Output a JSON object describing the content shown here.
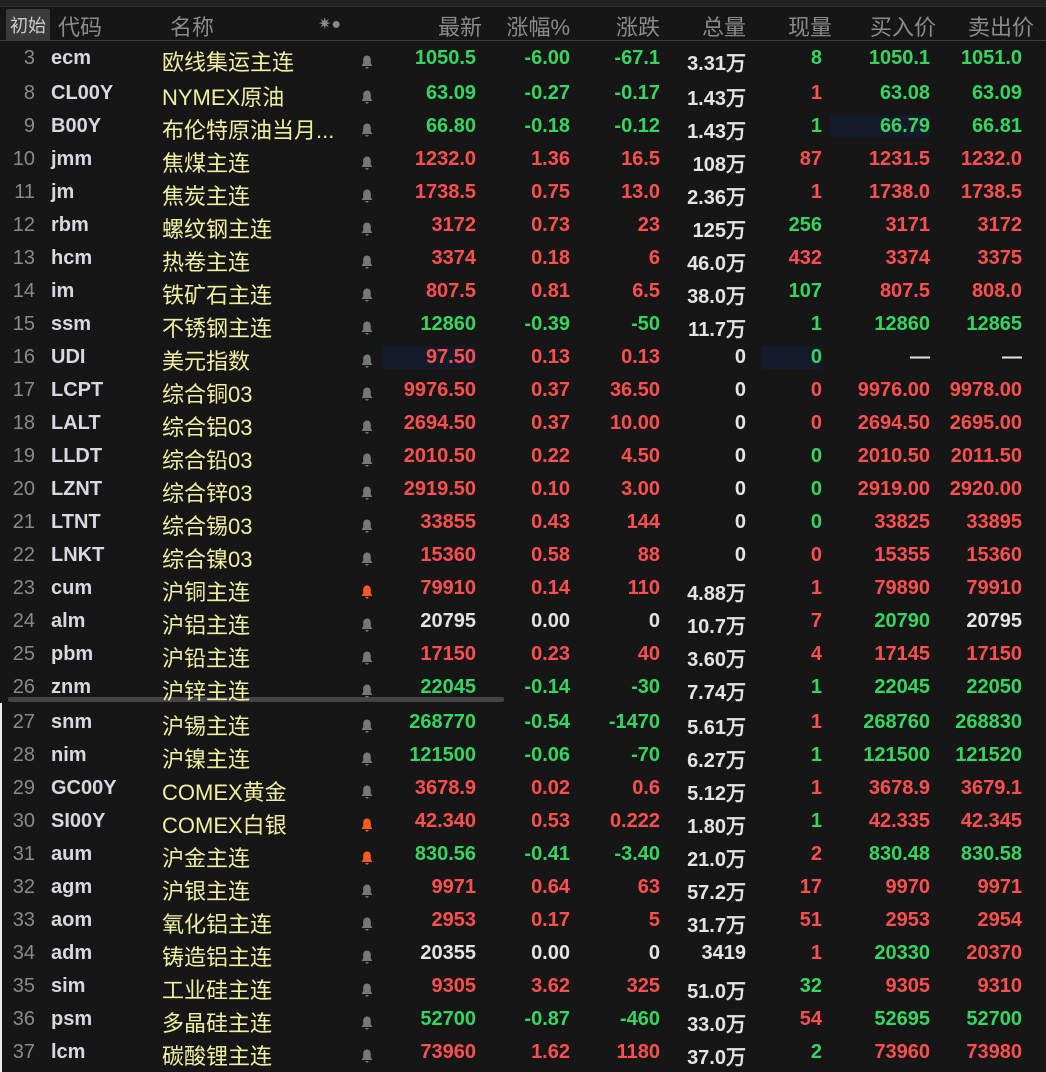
{
  "header": {
    "init": "初始",
    "code": "代码",
    "name": "名称",
    "icons": "✷●",
    "last": "最新",
    "pct": "涨幅%",
    "chg": "涨跌",
    "vol": "总量",
    "cur": "现量",
    "bid": "买入价",
    "ask": "卖出价"
  },
  "colors": {
    "green": "#35d660",
    "red": "#ff4f4f",
    "name": "#f2f0a0",
    "bell": "#777777",
    "bell_active": "#ff5a1f"
  },
  "rows": [
    {
      "n": "3",
      "code": "ecm",
      "name": "欧线集运主连",
      "bell": "gray",
      "v": [
        "1050.5",
        "-6.00",
        "-67.1",
        "3.31万",
        "8",
        "1050.1",
        "1051.0"
      ],
      "c": "gggwggg"
    },
    {
      "n": "8",
      "code": "CL00Y",
      "name": "NYMEX原油",
      "bell": "gray",
      "v": [
        "63.09",
        "-0.27",
        "-0.17",
        "1.43万",
        "1",
        "63.08",
        "63.09"
      ],
      "c": "gggwrgg"
    },
    {
      "n": "9",
      "code": "B00Y",
      "name": "布伦特原油当月...",
      "bell": "gray",
      "v": [
        "66.80",
        "-0.18",
        "-0.12",
        "1.43万",
        "1",
        "66.79",
        "66.81"
      ],
      "c": "gggwggg"
    },
    {
      "n": "10",
      "code": "jmm",
      "name": "焦煤主连",
      "bell": "gray",
      "v": [
        "1232.0",
        "1.36",
        "16.5",
        "108万",
        "87",
        "1231.5",
        "1232.0"
      ],
      "c": "rrrwrrr"
    },
    {
      "n": "11",
      "code": "jm",
      "name": "焦炭主连",
      "bell": "gray",
      "v": [
        "1738.5",
        "0.75",
        "13.0",
        "2.36万",
        "1",
        "1738.0",
        "1738.5"
      ],
      "c": "rrrwrrr"
    },
    {
      "n": "12",
      "code": "rbm",
      "name": "螺纹钢主连",
      "bell": "gray",
      "v": [
        "3172",
        "0.73",
        "23",
        "125万",
        "256",
        "3171",
        "3172"
      ],
      "c": "rrrwgrr"
    },
    {
      "n": "13",
      "code": "hcm",
      "name": "热卷主连",
      "bell": "gray",
      "v": [
        "3374",
        "0.18",
        "6",
        "46.0万",
        "432",
        "3374",
        "3375"
      ],
      "c": "rrrwrrr"
    },
    {
      "n": "14",
      "code": "im",
      "name": "铁矿石主连",
      "bell": "gray",
      "v": [
        "807.5",
        "0.81",
        "6.5",
        "38.0万",
        "107",
        "807.5",
        "808.0"
      ],
      "c": "rrrwgrr"
    },
    {
      "n": "15",
      "code": "ssm",
      "name": "不锈钢主连",
      "bell": "gray",
      "v": [
        "12860",
        "-0.39",
        "-50",
        "11.7万",
        "1",
        "12860",
        "12865"
      ],
      "c": "gggwggg"
    },
    {
      "n": "16",
      "code": "UDI",
      "name": "美元指数",
      "bell": "gray",
      "v": [
        "97.50",
        "0.13",
        "0.13",
        "0",
        "0",
        "—",
        "—"
      ],
      "c": "rrrwgww"
    },
    {
      "n": "17",
      "code": "LCPT",
      "name": "综合铜03",
      "bell": "gray",
      "v": [
        "9976.50",
        "0.37",
        "36.50",
        "0",
        "0",
        "9976.00",
        "9978.00"
      ],
      "c": "rrrwrrr"
    },
    {
      "n": "18",
      "code": "LALT",
      "name": "综合铝03",
      "bell": "gray",
      "v": [
        "2694.50",
        "0.37",
        "10.00",
        "0",
        "0",
        "2694.50",
        "2695.00"
      ],
      "c": "rrrwrrr"
    },
    {
      "n": "19",
      "code": "LLDT",
      "name": "综合铅03",
      "bell": "gray",
      "v": [
        "2010.50",
        "0.22",
        "4.50",
        "0",
        "0",
        "2010.50",
        "2011.50"
      ],
      "c": "rrrwgrr"
    },
    {
      "n": "20",
      "code": "LZNT",
      "name": "综合锌03",
      "bell": "gray",
      "v": [
        "2919.50",
        "0.10",
        "3.00",
        "0",
        "0",
        "2919.00",
        "2920.00"
      ],
      "c": "rrrwgrr"
    },
    {
      "n": "21",
      "code": "LTNT",
      "name": "综合锡03",
      "bell": "gray",
      "v": [
        "33855",
        "0.43",
        "144",
        "0",
        "0",
        "33825",
        "33895"
      ],
      "c": "rrrwgrr"
    },
    {
      "n": "22",
      "code": "LNKT",
      "name": "综合镍03",
      "bell": "gray",
      "v": [
        "15360",
        "0.58",
        "88",
        "0",
        "0",
        "15355",
        "15360"
      ],
      "c": "rrrwrrr"
    },
    {
      "n": "23",
      "code": "cum",
      "name": "沪铜主连",
      "bell": "active",
      "v": [
        "79910",
        "0.14",
        "110",
        "4.88万",
        "1",
        "79890",
        "79910"
      ],
      "c": "rrrwrrr"
    },
    {
      "n": "24",
      "code": "alm",
      "name": "沪铝主连",
      "bell": "gray",
      "v": [
        "20795",
        "0.00",
        "0",
        "10.7万",
        "7",
        "20790",
        "20795"
      ],
      "c": "wwwwrgw"
    },
    {
      "n": "25",
      "code": "pbm",
      "name": "沪铅主连",
      "bell": "gray",
      "v": [
        "17150",
        "0.23",
        "40",
        "3.60万",
        "4",
        "17145",
        "17150"
      ],
      "c": "rrrwrrr"
    },
    {
      "n": "26",
      "code": "znm",
      "name": "沪锌主连",
      "bell": "gray",
      "v": [
        "22045",
        "-0.14",
        "-30",
        "7.74万",
        "1",
        "22045",
        "22050"
      ],
      "c": "gggwggg"
    },
    {
      "n": "27",
      "code": "snm",
      "name": "沪锡主连",
      "bell": "gray",
      "v": [
        "268770",
        "-0.54",
        "-1470",
        "5.61万",
        "1",
        "268760",
        "268830"
      ],
      "c": "gggwrgg"
    },
    {
      "n": "28",
      "code": "nim",
      "name": "沪镍主连",
      "bell": "gray",
      "v": [
        "121500",
        "-0.06",
        "-70",
        "6.27万",
        "1",
        "121500",
        "121520"
      ],
      "c": "gggwggg"
    },
    {
      "n": "29",
      "code": "GC00Y",
      "name": "COMEX黄金",
      "bell": "gray",
      "v": [
        "3678.9",
        "0.02",
        "0.6",
        "5.12万",
        "1",
        "3678.9",
        "3679.1"
      ],
      "c": "rrrwrrr"
    },
    {
      "n": "30",
      "code": "SI00Y",
      "name": "COMEX白银",
      "bell": "active",
      "v": [
        "42.340",
        "0.53",
        "0.222",
        "1.80万",
        "1",
        "42.335",
        "42.345"
      ],
      "c": "rrrwgrr"
    },
    {
      "n": "31",
      "code": "aum",
      "name": "沪金主连",
      "bell": "active",
      "v": [
        "830.56",
        "-0.41",
        "-3.40",
        "21.0万",
        "2",
        "830.48",
        "830.58"
      ],
      "c": "gggwrgg"
    },
    {
      "n": "32",
      "code": "agm",
      "name": "沪银主连",
      "bell": "gray",
      "v": [
        "9971",
        "0.64",
        "63",
        "57.2万",
        "17",
        "9970",
        "9971"
      ],
      "c": "rrrwrrr"
    },
    {
      "n": "33",
      "code": "aom",
      "name": "氧化铝主连",
      "bell": "gray",
      "v": [
        "2953",
        "0.17",
        "5",
        "31.7万",
        "51",
        "2953",
        "2954"
      ],
      "c": "rrrwrrr"
    },
    {
      "n": "34",
      "code": "adm",
      "name": "铸造铝主连",
      "bell": "gray",
      "v": [
        "20355",
        "0.00",
        "0",
        "3419",
        "1",
        "20330",
        "20370"
      ],
      "c": "wwwwrgr"
    },
    {
      "n": "35",
      "code": "sim",
      "name": "工业硅主连",
      "bell": "gray",
      "v": [
        "9305",
        "3.62",
        "325",
        "51.0万",
        "32",
        "9305",
        "9310"
      ],
      "c": "rrrwgrr"
    },
    {
      "n": "36",
      "code": "psm",
      "name": "多晶硅主连",
      "bell": "gray",
      "v": [
        "52700",
        "-0.87",
        "-460",
        "33.0万",
        "54",
        "52695",
        "52700"
      ],
      "c": "gggwrgg"
    },
    {
      "n": "37",
      "code": "lcm",
      "name": "碳酸锂主连",
      "bell": "gray",
      "v": [
        "73960",
        "1.62",
        "1180",
        "37.0万",
        "2",
        "73960",
        "73980"
      ],
      "c": "rrrwgrr"
    }
  ]
}
